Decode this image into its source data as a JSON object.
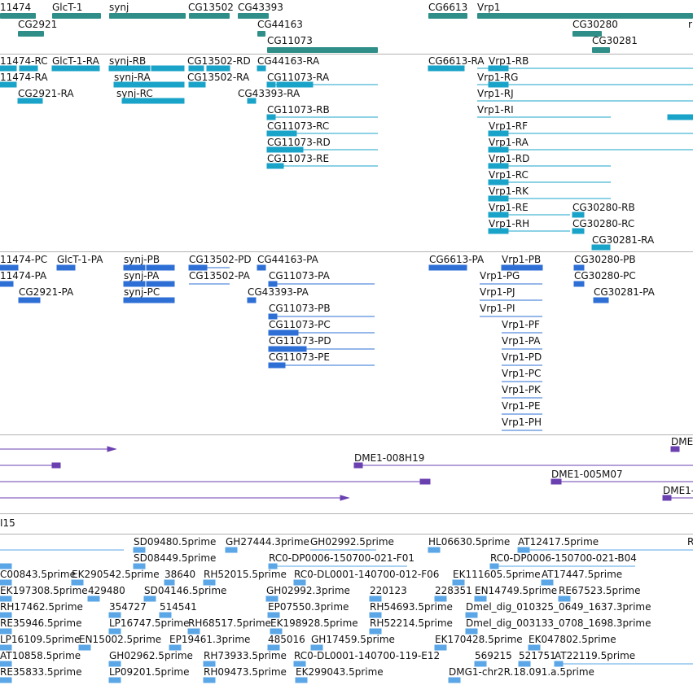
{
  "colors": {
    "gene": "#2f8f88",
    "transcript": "#1aa3c8",
    "protein": "#2e6fd6",
    "clone": "#6a3fb0",
    "est": "#5aa6e6",
    "separator": "#b3b3b3"
  },
  "gene_track": {
    "labels": [
      "11474",
      "GlcT-1",
      "synj",
      "CG13502",
      "CG43393",
      "CG6613",
      "Vrp1",
      "CG2921",
      "CG44163",
      "CG30280",
      "CG11073",
      "CG30281",
      "r"
    ]
  },
  "transcript_track": {
    "labels": [
      "11474-RC",
      "GlcT-1-RA",
      "synj-RB",
      "CG13502-RD",
      "CG44163-RA",
      "CG6613-RA",
      "Vrp1-RB",
      "11474-RA",
      "synj-RA",
      "CG13502-RA",
      "CG11073-RA",
      "Vrp1-RG",
      "CG2921-RA",
      "synj-RC",
      "CG43393-RA",
      "Vrp1-RJ",
      "CG11073-RB",
      "Vrp1-RI",
      "CG11073-RC",
      "Vrp1-RF",
      "CG11073-RD",
      "Vrp1-RA",
      "CG11073-RE",
      "Vrp1-RD",
      "Vrp1-RC",
      "Vrp1-RK",
      "Vrp1-RE",
      "CG30280-RB",
      "Vrp1-RH",
      "CG30280-RC",
      "CG30281-RA"
    ]
  },
  "protein_track": {
    "labels": [
      "11474-PC",
      "GlcT-1-PA",
      "synj-PB",
      "CG13502-PD",
      "CG44163-PA",
      "CG6613-PA",
      "Vrp1-PB",
      "CG30280-PB",
      "11474-PA",
      "synj-PA",
      "CG13502-PA",
      "CG11073-PA",
      "Vrp1-PG",
      "CG30280-PC",
      "CG2921-PA",
      "synj-PC",
      "CG43393-PA",
      "Vrp1-PJ",
      "CG30281-PA",
      "CG11073-PB",
      "Vrp1-PI",
      "CG11073-PC",
      "Vrp1-PF",
      "CG11073-PD",
      "Vrp1-PA",
      "CG11073-PE",
      "Vrp1-PD",
      "Vrp1-PC",
      "Vrp1-PK",
      "Vrp1-PE",
      "Vrp1-PH"
    ]
  },
  "clone_track": {
    "labels": [
      "DME",
      "DME1-008H19",
      "DME1-005M07",
      "DME1-"
    ]
  },
  "partial_track": {
    "label": "I15"
  },
  "est_track": {
    "labels": [
      "SD09480.5prime",
      "GH27444.3prime",
      "GH02992.5prime",
      "HL06630.5prime",
      "AT12417.5prime",
      "R",
      "SD08449.5prime",
      "RC0-DP0006-150700-021-F01",
      "RC0-DP0006-150700-021-B04",
      "C00843.5prime",
      "EK290542.5prime",
      "38640",
      "RH52015.5prime",
      "RC0-DL0001-140700-012-F06",
      "EK111605.5prime",
      "AT17447.5prime",
      "EK197308.5prime",
      "429480",
      "SD04146.5prime",
      "GH02992.3prime",
      "220123",
      "228351",
      "EN14749.5prime",
      "RE67523.5prime",
      "RH17462.5prime",
      "354727",
      "514541",
      "EP07550.3prime",
      "RH54693.5prime",
      "Dmel_dig_010325_0649_1637.3prime",
      "RE35946.5prime",
      "LP16747.5prime",
      "RH68517.5prime",
      "EK198928.5prime",
      "RH52214.5prime",
      "Dmel_dig_003133_0708_1698.3prime",
      "LP16109.5prime",
      "EN15002.5prime",
      "EP19461.3prime",
      "485016",
      "GH17459.5prime",
      "EK170428.5prime",
      "EK047802.5prime",
      "AT10858.5prime",
      "GH02962.5prime",
      "RH73933.5prime",
      "RC0-DL0001-140700-119-E12",
      "569215",
      "521751",
      "AT22119.5prime",
      "RE35833.5prime",
      "LP09201.5prime",
      "RH09473.5prime",
      "EK299043.5prime",
      "DMG1-chr2R.18.091.a.5prime"
    ]
  }
}
